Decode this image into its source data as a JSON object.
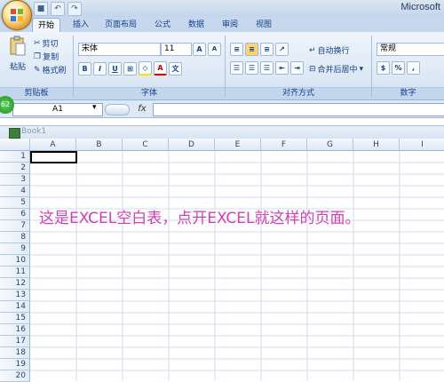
{
  "app_title": "Microsoft",
  "tabs": [
    "开始",
    "插入",
    "页面布局",
    "公式",
    "数据",
    "审阅",
    "视图"
  ],
  "clipboard": {
    "paste": "粘贴",
    "cut": "剪切",
    "copy": "复制",
    "format_painter": "格式刷",
    "group": "剪贴板"
  },
  "font": {
    "name": "宋体",
    "size": "11",
    "bold": "B",
    "italic": "I",
    "underline": "U",
    "grow": "A",
    "shrink": "A",
    "group": "字体"
  },
  "alignment": {
    "wrap": "自动换行",
    "merge": "合并后居中",
    "group": "对齐方式"
  },
  "number": {
    "format": "常规",
    "percent": "%",
    "comma": ",",
    "group": "数字"
  },
  "formula_bar": {
    "cell": "A1",
    "fx": "fx"
  },
  "workbook_name": "Book1",
  "columns": [
    "A",
    "B",
    "C",
    "D",
    "E",
    "F",
    "G",
    "H",
    "I"
  ],
  "rows": [
    "1",
    "2",
    "3",
    "4",
    "5",
    "6",
    "7",
    "8",
    "9",
    "10",
    "11",
    "12",
    "13",
    "14",
    "15",
    "16",
    "17",
    "18",
    "19",
    "20"
  ],
  "overlay_caption": "这是EXCEL空白表，点开EXCEL就这样的页面。",
  "badge": "62",
  "colors": {
    "ribbon": "#dde8f5",
    "caption": "#d13fb4",
    "header": "#15428b"
  }
}
